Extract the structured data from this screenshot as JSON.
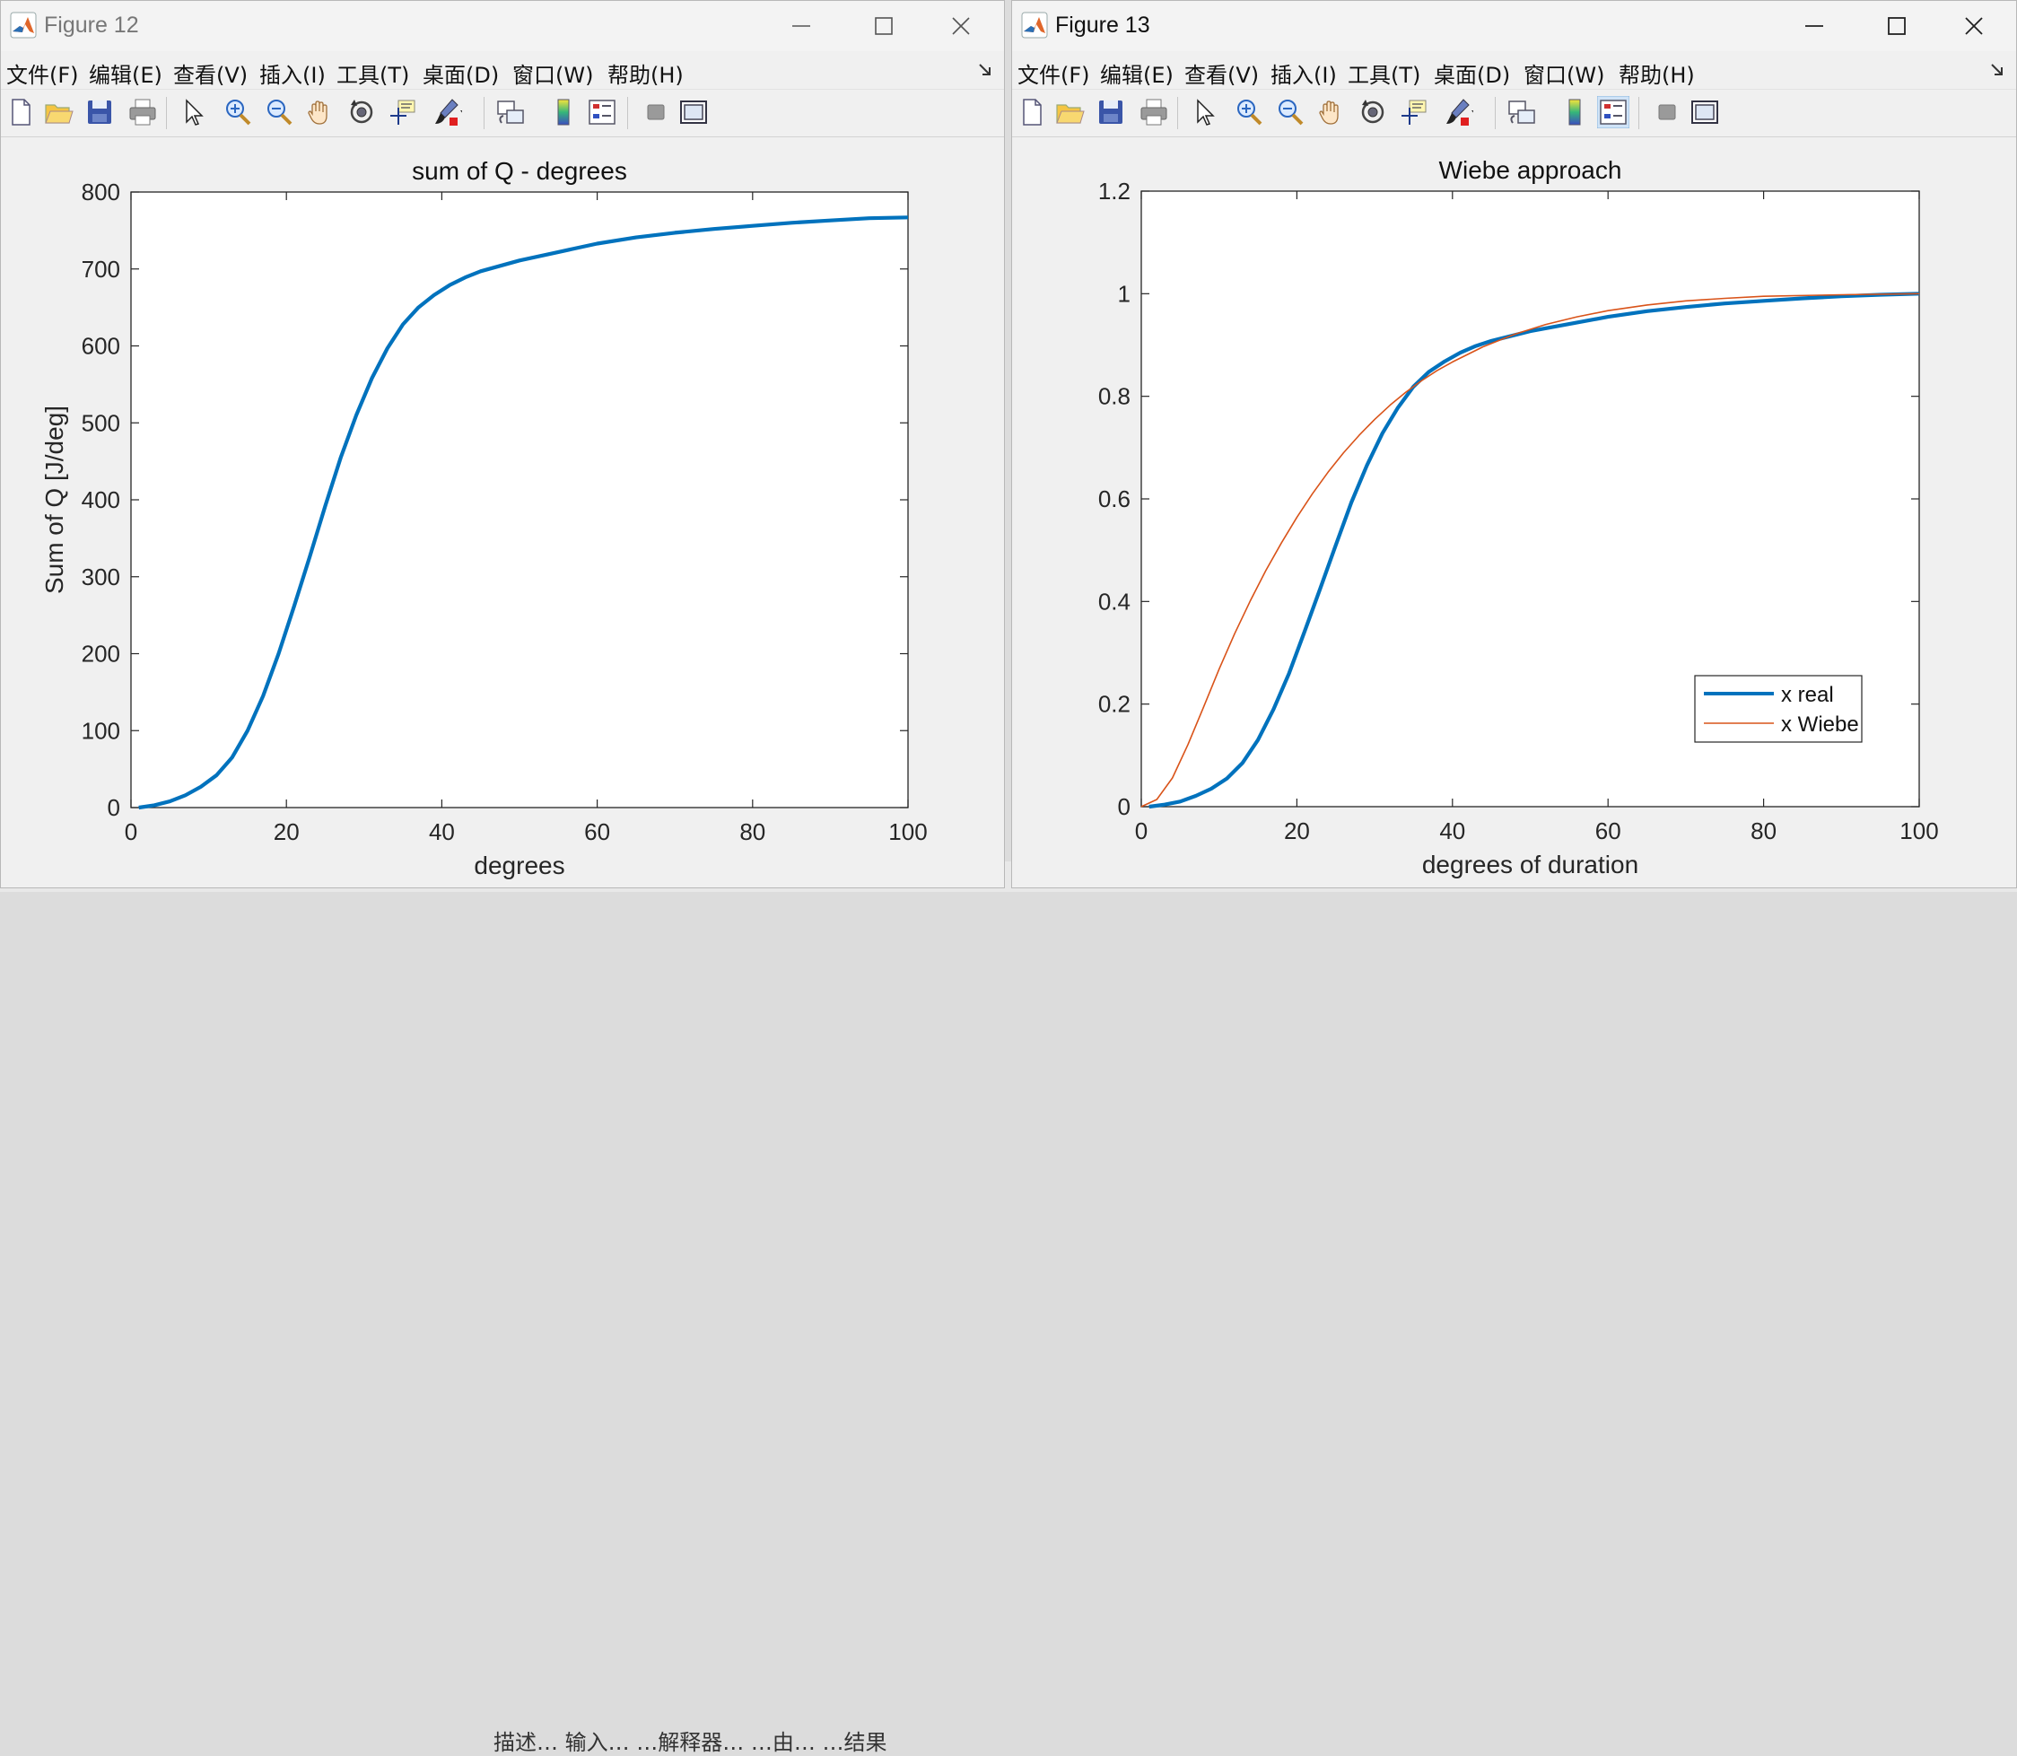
{
  "background_text": "描述…    输入…    …解释器…    …由…    …结果",
  "menu_labels": [
    "文件(F)",
    "编辑(E)",
    "查看(V)",
    "插入(I)",
    "工具(T)",
    "桌面(D)",
    "窗口(W)",
    "帮助(H)"
  ],
  "toolbar_icons": [
    "new-figure-icon",
    "open-file-icon",
    "save-icon",
    "print-icon",
    "select-arrow-icon",
    "zoom-in-icon",
    "zoom-out-icon",
    "pan-hand-icon",
    "rotate-3d-icon",
    "data-cursor-icon",
    "brush-icon",
    "link-plot-icon",
    "colorbar-icon",
    "legend-icon",
    "hide-plot-tools-icon",
    "show-plot-tools-icon"
  ],
  "figure12": {
    "window_title": "Figure 12",
    "menu": [
      "文件(F)",
      "编辑(E)",
      "查看(V)",
      "插入(I)",
      "工具(T)",
      "桌面(D)",
      "窗口(W)",
      "帮助(H)"
    ],
    "chart_data": {
      "type": "line",
      "title": "sum of Q - degrees",
      "xlabel": "degrees",
      "ylabel": "Sum of Q [J/deg]",
      "xlim": [
        0,
        100
      ],
      "ylim": [
        0,
        800
      ],
      "xticks": [
        "0",
        "20",
        "40",
        "60",
        "80",
        "100"
      ],
      "yticks": [
        "0",
        "100",
        "200",
        "300",
        "400",
        "500",
        "600",
        "700",
        "800"
      ],
      "grid": false,
      "series": [
        {
          "color": "#0072BD",
          "x": [
            1,
            3,
            5,
            7,
            9,
            11,
            13,
            15,
            17,
            19,
            21,
            23,
            25,
            27,
            29,
            31,
            33,
            35,
            37,
            39,
            41,
            43,
            45,
            50,
            55,
            60,
            65,
            70,
            75,
            80,
            85,
            90,
            95,
            100
          ],
          "y": [
            0,
            3,
            8,
            16,
            27,
            42,
            65,
            100,
            145,
            200,
            262,
            326,
            392,
            455,
            510,
            558,
            597,
            628,
            650,
            666,
            679,
            689,
            697,
            711,
            722,
            733,
            741,
            747,
            752,
            756,
            760,
            763,
            766,
            767
          ]
        }
      ]
    }
  },
  "figure13": {
    "window_title": "Figure 13",
    "menu": [
      "文件(F)",
      "编辑(E)",
      "查看(V)",
      "插入(I)",
      "工具(T)",
      "桌面(D)",
      "窗口(W)",
      "帮助(H)"
    ],
    "chart_data": {
      "type": "line",
      "title": "Wiebe approach",
      "xlabel": "degrees of duration",
      "ylabel": "",
      "xlim": [
        0,
        100
      ],
      "ylim": [
        0,
        1.2
      ],
      "xticks": [
        "0",
        "20",
        "40",
        "60",
        "80",
        "100"
      ],
      "yticks": [
        "0",
        "0.2",
        "0.4",
        "0.6",
        "0.8",
        "1",
        "1.2"
      ],
      "grid": false,
      "legend_position": "bottom-right",
      "series": [
        {
          "name": "x real",
          "color": "#0072BD",
          "x": [
            1,
            3,
            5,
            7,
            9,
            11,
            13,
            15,
            17,
            19,
            21,
            23,
            25,
            27,
            29,
            31,
            33,
            35,
            37,
            39,
            41,
            43,
            45,
            50,
            55,
            60,
            65,
            70,
            75,
            80,
            85,
            90,
            95,
            100
          ],
          "y": [
            0,
            0.004,
            0.01,
            0.021,
            0.035,
            0.055,
            0.085,
            0.13,
            0.19,
            0.26,
            0.342,
            0.425,
            0.51,
            0.593,
            0.665,
            0.728,
            0.778,
            0.819,
            0.848,
            0.868,
            0.885,
            0.898,
            0.908,
            0.927,
            0.941,
            0.955,
            0.966,
            0.974,
            0.981,
            0.986,
            0.991,
            0.995,
            0.998,
            1.0
          ]
        },
        {
          "name": "x Wiebe",
          "color": "#D95319",
          "x": [
            0,
            2,
            4,
            6,
            8,
            10,
            12,
            14,
            16,
            18,
            20,
            22,
            24,
            26,
            28,
            30,
            32,
            34,
            36,
            38,
            40,
            44,
            48,
            52,
            56,
            60,
            65,
            70,
            75,
            80,
            90,
            100
          ],
          "y": [
            0,
            0.014,
            0.056,
            0.121,
            0.194,
            0.268,
            0.337,
            0.401,
            0.46,
            0.514,
            0.564,
            0.61,
            0.652,
            0.69,
            0.724,
            0.755,
            0.783,
            0.808,
            0.83,
            0.85,
            0.867,
            0.897,
            0.921,
            0.94,
            0.955,
            0.967,
            0.978,
            0.986,
            0.991,
            0.995,
            0.998,
            1.0
          ]
        }
      ]
    }
  }
}
